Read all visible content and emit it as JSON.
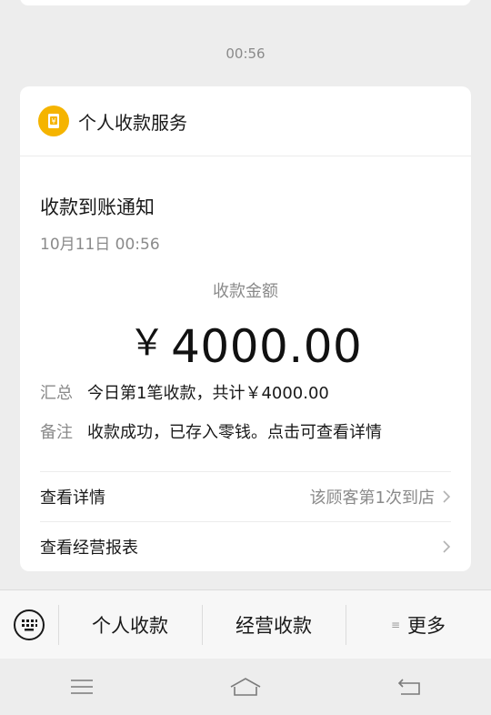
{
  "chat": {
    "timestamp": "00:56"
  },
  "card": {
    "service_name": "个人收款服务",
    "service_icon": "wallet-yen-icon",
    "title": "收款到账通知",
    "time": "10月11日 00:56",
    "amount_label": "收款金额",
    "currency": "￥",
    "amount": "4000.00",
    "summary_key": "汇总",
    "summary_value": "今日第1笔收款，共计￥4000.00",
    "note_key": "备注",
    "note_value": "收款成功，已存入零钱。点击可查看详情",
    "links": [
      {
        "label": "查看详情",
        "hint": "该顾客第1次到店"
      },
      {
        "label": "查看经营报表",
        "hint": ""
      }
    ]
  },
  "menu": {
    "keyboard_icon": "keyboard-icon",
    "items": [
      "个人收款",
      "经营收款",
      "更多"
    ]
  },
  "system_nav": {
    "icons": [
      "menu-icon",
      "home-icon",
      "back-icon"
    ]
  },
  "colors": {
    "accent": "#f5b400",
    "background": "#ededed",
    "card": "#ffffff",
    "secondary_text": "#8a8a8a"
  }
}
